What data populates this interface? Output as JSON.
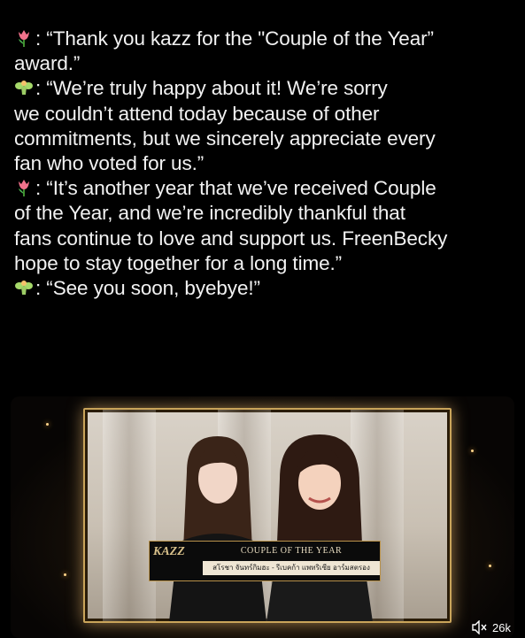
{
  "post": {
    "lines": [
      {
        "speaker_icon": "tulip-emoji",
        "text": ": “Thank you kazz for the \"Couple of the Year”"
      },
      {
        "speaker_icon": "",
        "text": "award.”"
      },
      {
        "speaker_icon": "fairy-emoji",
        "text": ": “We’re truly happy about it! We’re sorry"
      },
      {
        "speaker_icon": "",
        "text": "we couldn’t attend today because of other"
      },
      {
        "speaker_icon": "",
        "text": "commitments, but we sincerely appreciate every"
      },
      {
        "speaker_icon": "",
        "text": "fan who voted for us.”"
      },
      {
        "speaker_icon": "tulip-emoji",
        "text": ": “It’s another year that we’ve received Couple"
      },
      {
        "speaker_icon": "",
        "text": "of the Year, and we’re incredibly thankful that"
      },
      {
        "speaker_icon": "",
        "text": "fans continue to love and support us. FreenBecky"
      },
      {
        "speaker_icon": "",
        "text": "hope to stay together for a long time.”"
      },
      {
        "speaker_icon": "fairy-emoji",
        "text": ": “See you soon, byebye!”"
      }
    ]
  },
  "video": {
    "award_title": "COUPLE OF THE YEAR",
    "names": "สโรชา จันทร์กิมฮะ - รีเบคก้า แพทริเซีย อาร์มสตรอง",
    "logo_text": "KAZZ",
    "view_count": "26k",
    "mute_icon": "speaker-muted-icon"
  },
  "colors": {
    "background": "#000000",
    "text": "#f2f2f2",
    "frame_gold": "#c9a45a"
  }
}
